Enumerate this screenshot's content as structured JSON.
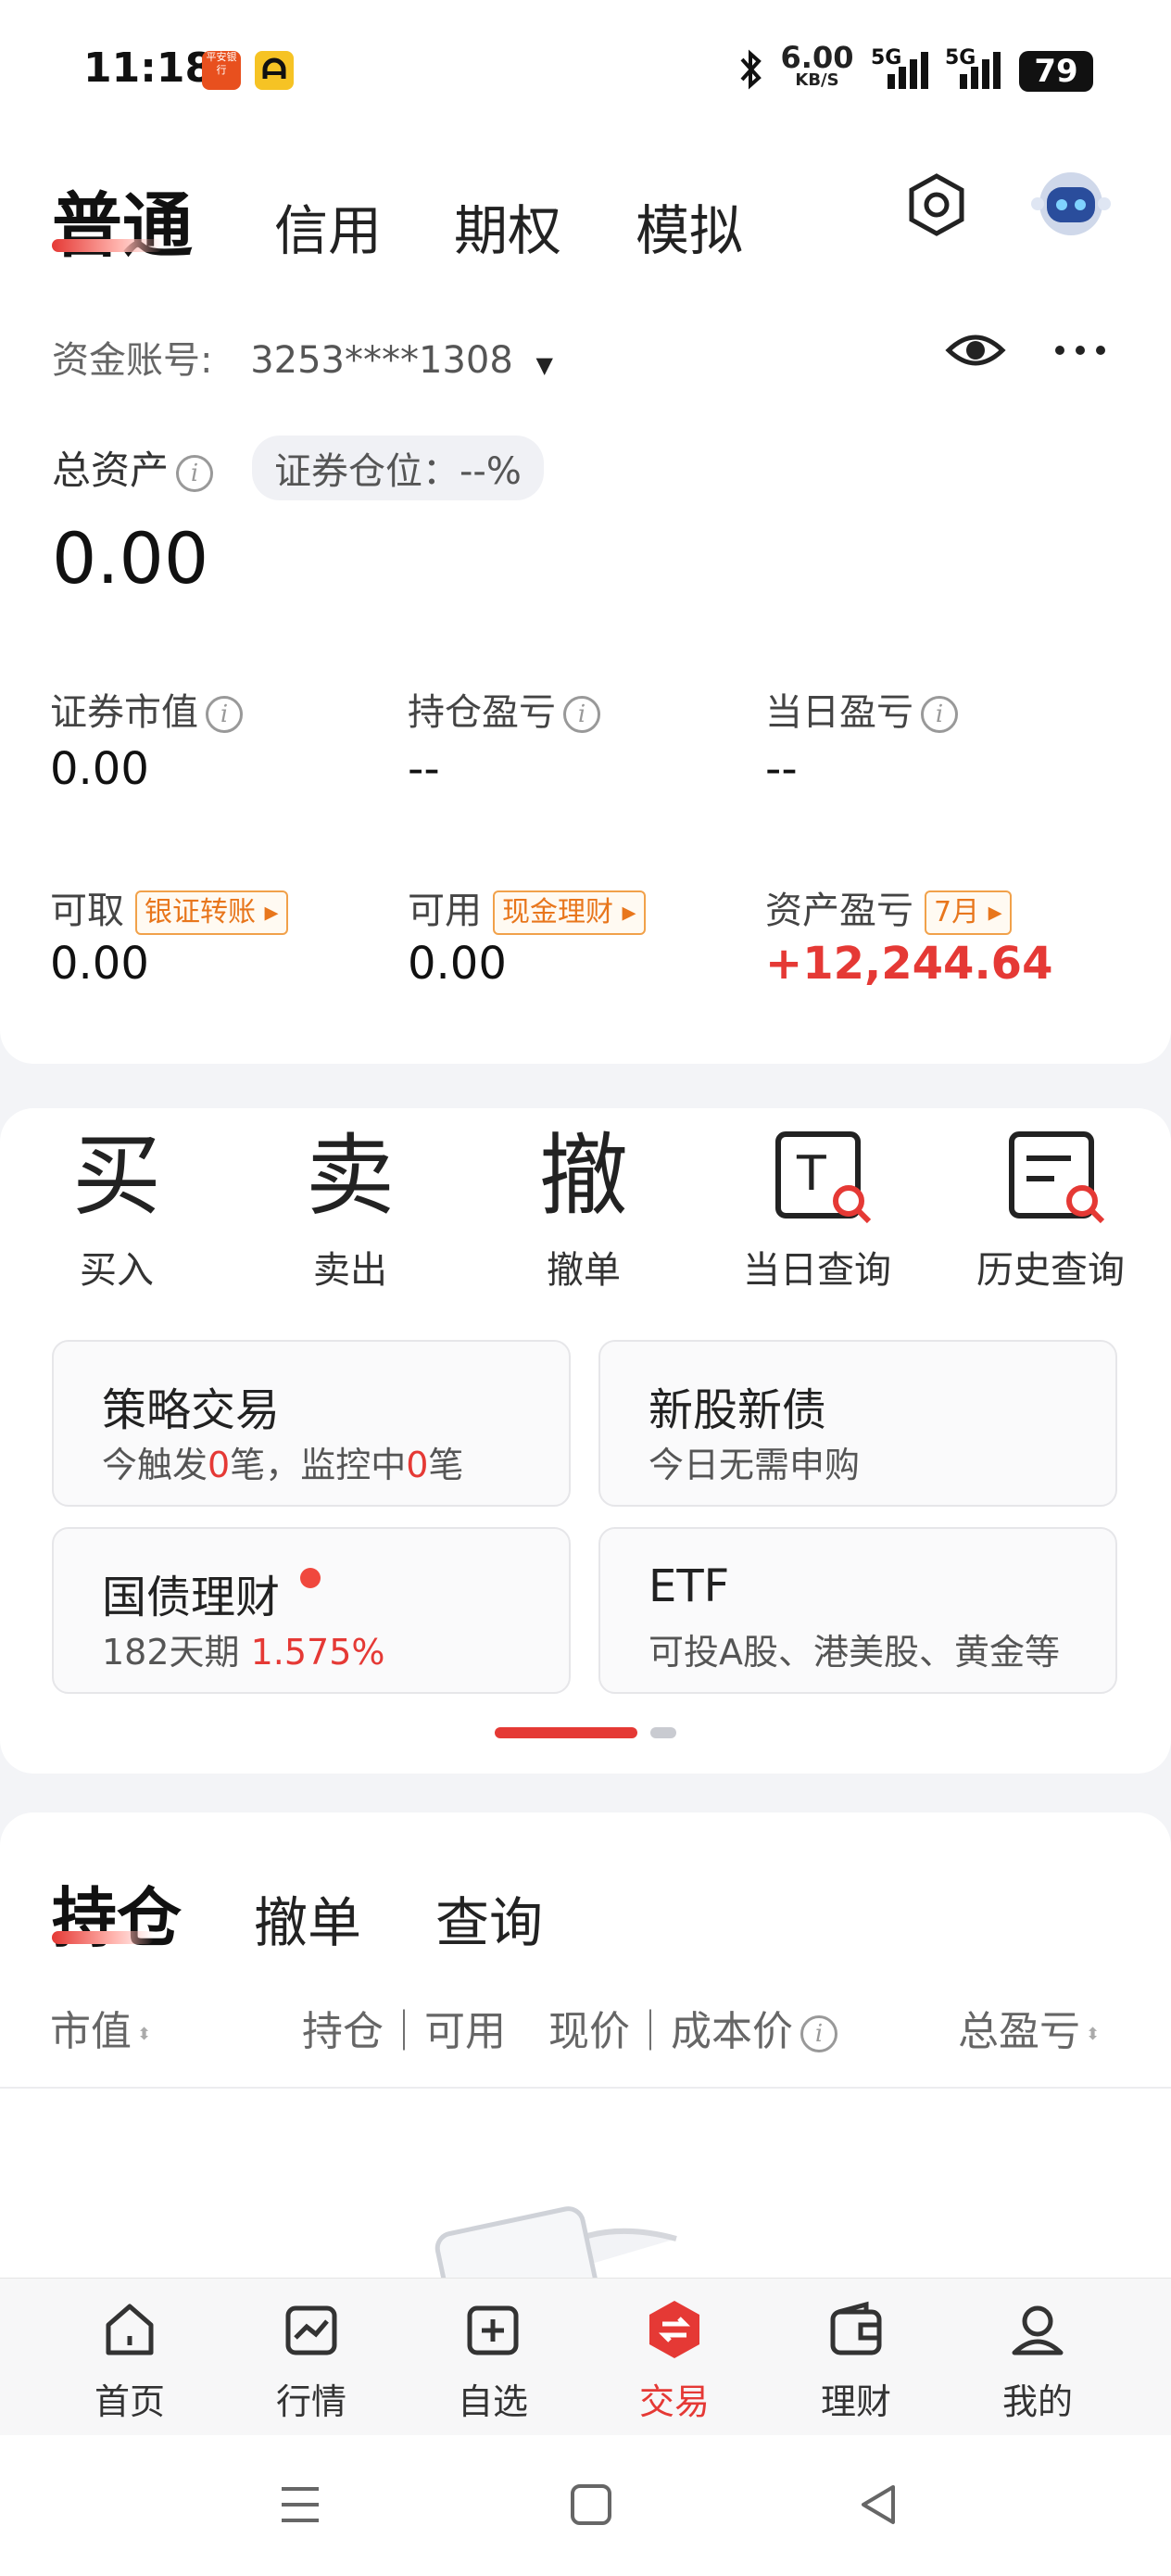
{
  "status": {
    "time": "11:18",
    "speed": "6.00",
    "speed_unit": "KB/S",
    "net1": "5G",
    "net2": "5G",
    "battery": "79",
    "app1": "平安银行"
  },
  "tabs": [
    "普通",
    "信用",
    "期权",
    "模拟"
  ],
  "account": {
    "label": "资金账号:",
    "number": "3253****1308"
  },
  "total_assets": {
    "label": "总资产",
    "value": "0.00",
    "position_label": "证券仓位：--%"
  },
  "metrics_row1": [
    {
      "label": "证券市值",
      "value": "0.00"
    },
    {
      "label": "持仓盈亏",
      "value": "--"
    },
    {
      "label": "当日盈亏",
      "value": "--"
    }
  ],
  "metrics_row2": [
    {
      "label": "可取",
      "badge": "银证转账",
      "value": "0.00"
    },
    {
      "label": "可用",
      "badge": "现金理财",
      "value": "0.00"
    },
    {
      "label": "资产盈亏",
      "badge": "7月",
      "value": "+12,244.64"
    }
  ],
  "quick_actions": [
    {
      "label": "买入",
      "glyph": "买",
      "icon": "buy-icon"
    },
    {
      "label": "卖出",
      "glyph": "卖",
      "icon": "sell-icon"
    },
    {
      "label": "撤单",
      "glyph": "撤",
      "icon": "cancel-order-icon"
    },
    {
      "label": "当日查询",
      "glyph": "T",
      "icon": "today-query-icon"
    },
    {
      "label": "历史查询",
      "glyph": "",
      "icon": "history-query-icon"
    }
  ],
  "feature_cards": [
    {
      "title": "策略交易",
      "sub_a": "今触发",
      "num_a": "0",
      "sub_b": "笔，监控中",
      "num_b": "0",
      "sub_c": "笔"
    },
    {
      "title": "新股新债",
      "sub": "今日无需申购"
    },
    {
      "title": "国债理财",
      "sub": "182天期",
      "rate": "1.575%"
    },
    {
      "title": "ETF",
      "sub": "可投A股、港美股、黄金等"
    }
  ],
  "positions": {
    "tabs": [
      "持仓",
      "撤单",
      "查询"
    ],
    "columns": [
      "市值",
      "持仓｜可用",
      "现价｜成本价",
      "总盈亏"
    ]
  },
  "bottom_nav": [
    {
      "label": "首页",
      "icon": "home-icon"
    },
    {
      "label": "行情",
      "icon": "market-icon"
    },
    {
      "label": "自选",
      "icon": "watchlist-icon"
    },
    {
      "label": "交易",
      "icon": "trade-icon"
    },
    {
      "label": "理财",
      "icon": "wallet-icon"
    },
    {
      "label": "我的",
      "icon": "profile-icon"
    }
  ],
  "colors": {
    "accent": "#e53935",
    "badge": "#e8761c"
  }
}
